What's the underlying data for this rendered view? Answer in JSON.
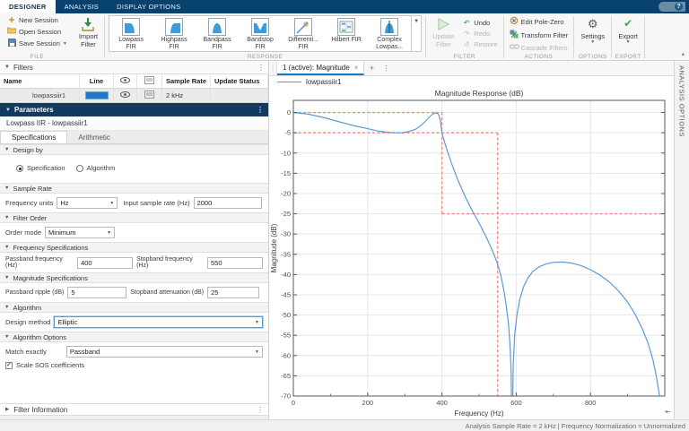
{
  "app_tabs": [
    {
      "label": "DESIGNER",
      "active": true
    },
    {
      "label": "ANALYSIS",
      "active": false
    },
    {
      "label": "DISPLAY OPTIONS",
      "active": false
    }
  ],
  "help_label": "?",
  "ribbon": {
    "file_section": "FILE",
    "new_session": "New Session",
    "open_session": "Open Session",
    "save_session": "Save Session",
    "import_l1": "Import",
    "import_l2": "Filter",
    "response_section": "RESPONSE",
    "gallery": [
      {
        "l1": "Lowpass",
        "l2": "FIR"
      },
      {
        "l1": "Highpass",
        "l2": "FIR"
      },
      {
        "l1": "Bandpass",
        "l2": "FIR"
      },
      {
        "l1": "Bandstop",
        "l2": "FIR"
      },
      {
        "l1": "Differenti...",
        "l2": "FIR"
      },
      {
        "l1": "Hilbert FIR",
        "l2": ""
      },
      {
        "l1": "Complex",
        "l2": "Lowpas..."
      }
    ],
    "filter_section": "FILTER",
    "update_l1": "Update",
    "update_l2": "Filter",
    "undo": "Undo",
    "redo": "Redo",
    "restore": "Restore",
    "actions_section": "ACTIONS",
    "edit_pole_zero": "Edit Pole-Zero",
    "transform_filter": "Transform Filter",
    "cascade_filters": "Cascade Filters",
    "options_section": "OPTIONS",
    "settings": "Settings",
    "export_section": "EXPORT",
    "export": "Export"
  },
  "filters": {
    "title": "Filters",
    "columns": [
      "Name",
      "Line",
      "",
      "",
      "Sample Rate",
      "Update Status"
    ],
    "row": {
      "name": "lowpassiir1",
      "sample_rate": "2 kHz",
      "update_status": ""
    },
    "line_color": "#1f78c8"
  },
  "parameters": {
    "title": "Parameters",
    "subtitle": "Lowpass IIR - lowpassiir1",
    "tabs": [
      "Specifications",
      "Arithmetic"
    ],
    "design_by": {
      "title": "Design by",
      "option1": "Specification",
      "option2": "Algorithm",
      "selected": "Specification"
    },
    "sample_rate": {
      "title": "Sample Rate",
      "freq_units_label": "Frequency units",
      "freq_units_value": "Hz",
      "input_rate_label": "Input sample rate (Hz)",
      "input_rate_value": "2000"
    },
    "filter_order": {
      "title": "Filter Order",
      "order_mode_label": "Order mode",
      "order_mode_value": "Minimum"
    },
    "freq_specs": {
      "title": "Frequency Specifications",
      "passband_label": "Passband frequency (Hz)",
      "passband_value": "400",
      "stopband_label": "Stopband frequency (Hz)",
      "stopband_value": "550"
    },
    "mag_specs": {
      "title": "Magnitude Specifications",
      "ripple_label": "Passband ripple (dB)",
      "ripple_value": "5",
      "atten_label": "Stopband attenuation (dB)",
      "atten_value": "25"
    },
    "algorithm": {
      "title": "Algorithm",
      "design_method_label": "Design method",
      "design_method_value": "Elliptic"
    },
    "algo_options": {
      "title": "Algorithm Options",
      "match_label": "Match exactly",
      "match_value": "Passband",
      "scale_sos_label": "Scale SOS coefficients",
      "scale_sos_checked": true
    },
    "filter_info": {
      "title": "Filter Information"
    }
  },
  "plot": {
    "tab_label": "1 (active): Magnitude",
    "close_glyph": "×",
    "new_tab_glyph": "+",
    "legend": "lowpassiir1",
    "analysis_options_label": "ANALYSIS OPTIONS",
    "chart_data": {
      "type": "line",
      "title": "Magnitude Response (dB)",
      "xlabel": "Frequency (Hz)",
      "ylabel": "Magnitude (dB)",
      "xlim": [
        0,
        1000
      ],
      "ylim": [
        -70,
        3
      ],
      "xticks": [
        0,
        200,
        400,
        600,
        800
      ],
      "xminor": [
        100,
        300,
        500,
        700,
        900
      ],
      "yticks": [
        0,
        -5,
        -10,
        -15,
        -20,
        -25,
        -30,
        -35,
        -40,
        -45,
        -50,
        -55,
        -60,
        -65,
        -70
      ],
      "grid": true,
      "legend_position": "top-left-outside",
      "series": [
        {
          "name": "lowpassiir1",
          "color": "#5b9bd5",
          "points": [
            [
              0,
              0
            ],
            [
              40,
              -0.4
            ],
            [
              80,
              -1.2
            ],
            [
              120,
              -2.2
            ],
            [
              160,
              -3.2
            ],
            [
              200,
              -4.0
            ],
            [
              230,
              -4.6
            ],
            [
              260,
              -4.95
            ],
            [
              290,
              -5.0
            ],
            [
              310,
              -4.75
            ],
            [
              330,
              -4.1
            ],
            [
              345,
              -3.1
            ],
            [
              355,
              -2.2
            ],
            [
              365,
              -1.2
            ],
            [
              372,
              -0.6
            ],
            [
              378,
              -0.25
            ],
            [
              383,
              -0.1
            ],
            [
              388,
              -0.2
            ],
            [
              392,
              -0.7
            ],
            [
              396,
              -2.0
            ],
            [
              400,
              -5.0
            ],
            [
              408,
              -7.6
            ],
            [
              416,
              -9.9
            ],
            [
              425,
              -12.3
            ],
            [
              435,
              -14.8
            ],
            [
              445,
              -17.1
            ],
            [
              455,
              -19.2
            ],
            [
              466,
              -21.4
            ],
            [
              478,
              -23.6
            ],
            [
              490,
              -25.6
            ],
            [
              505,
              -28.2
            ],
            [
              520,
              -30.9
            ],
            [
              535,
              -33.9
            ],
            [
              548,
              -36.9
            ],
            [
              558,
              -40
            ],
            [
              566,
              -43.5
            ],
            [
              573,
              -47.5
            ],
            [
              579,
              -52
            ],
            [
              583,
              -57
            ],
            [
              586,
              -63
            ],
            [
              588,
              -74
            ],
            [
              590,
              -74
            ],
            [
              592,
              -62
            ],
            [
              596,
              -55
            ],
            [
              602,
              -50
            ],
            [
              610,
              -46
            ],
            [
              620,
              -43
            ],
            [
              632,
              -40.8
            ],
            [
              645,
              -39.2
            ],
            [
              660,
              -38.2
            ],
            [
              680,
              -37.4
            ],
            [
              700,
              -37.0
            ],
            [
              725,
              -36.9
            ],
            [
              750,
              -37.2
            ],
            [
              775,
              -37.8
            ],
            [
              800,
              -38.8
            ],
            [
              825,
              -40.1
            ],
            [
              850,
              -41.8
            ],
            [
              875,
              -44
            ],
            [
              900,
              -46.8
            ],
            [
              920,
              -49.8
            ],
            [
              940,
              -53.5
            ],
            [
              955,
              -57
            ],
            [
              968,
              -61
            ],
            [
              978,
              -65.5
            ],
            [
              985,
              -69.5
            ],
            [
              989,
              -74
            ]
          ]
        }
      ],
      "spec_mask": {
        "color": "#f2877b",
        "segments": [
          [
            [
              0,
              0
            ],
            [
              400,
              0
            ]
          ],
          [
            [
              400,
              0
            ],
            [
              400,
              -25
            ]
          ],
          [
            [
              400,
              -25
            ],
            [
              1000,
              -25
            ]
          ],
          [
            [
              0,
              -5
            ],
            [
              550,
              -5
            ]
          ],
          [
            [
              550,
              -5
            ],
            [
              550,
              -70
            ]
          ]
        ]
      }
    }
  },
  "status_bar": {
    "text": "Analysis Sample Rate = 2 kHz | Frequency Normalization = Unnormalized"
  }
}
